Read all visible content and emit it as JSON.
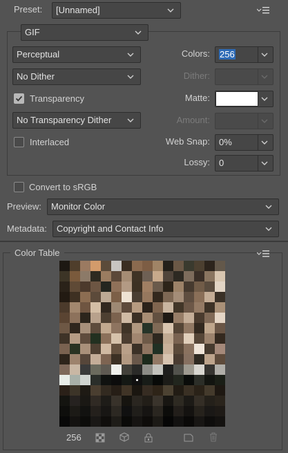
{
  "preset": {
    "label": "Preset:",
    "value": "[Unnamed]"
  },
  "format": {
    "value": "GIF"
  },
  "reduction": {
    "value": "Perceptual"
  },
  "dither_algo": {
    "value": "No Dither"
  },
  "transparency": {
    "label": "Transparency",
    "checked": true
  },
  "transparency_dither": {
    "value": "No Transparency Dither"
  },
  "interlaced": {
    "label": "Interlaced",
    "checked": false
  },
  "colors": {
    "label": "Colors:",
    "value": "256"
  },
  "dither": {
    "label": "Dither:",
    "value": ""
  },
  "matte": {
    "label": "Matte:",
    "color": "#ffffff"
  },
  "amount": {
    "label": "Amount:",
    "value": ""
  },
  "web_snap": {
    "label": "Web Snap:",
    "value": "0%"
  },
  "lossy": {
    "label": "Lossy:",
    "value": "0"
  },
  "convert_srgb": {
    "label": "Convert to sRGB",
    "checked": false
  },
  "preview": {
    "label": "Preview:",
    "value": "Monitor Color"
  },
  "metadata": {
    "label": "Metadata:",
    "value": "Copyright and Contact Info"
  },
  "color_table": {
    "title": "Color Table",
    "count": "256",
    "colors": [
      "#1d1812",
      "#4f3e2b",
      "#9b7a61",
      "#d39b6b",
      "#5b4b3a",
      "#c8c5c1",
      "#3a2e22",
      "#8b6a4f",
      "#7d5d44",
      "#a08466",
      "#24201a",
      "#6b5846",
      "#3a3a2e",
      "#4c4030",
      "#2c241c",
      "#63584a",
      "#3c3426",
      "#7a5a3c",
      "#8c7a68",
      "#2e2a20",
      "#9a7c60",
      "#5c4838",
      "#a58c74",
      "#3f3325",
      "#6e6054",
      "#c7a98b",
      "#50443a",
      "#2d2922",
      "#7d6c5c",
      "#3a2f27",
      "#8a7560",
      "#d8c6b0",
      "#2a2219",
      "#5f4a36",
      "#4c3a2c",
      "#6d5643",
      "#24261f",
      "#8f7159",
      "#b39a84",
      "#3d3123",
      "#a07f63",
      "#6a5a4b",
      "#2d2419",
      "#9c8268",
      "#463a2f",
      "#715c48",
      "#5a4c3e",
      "#e2d5c5",
      "#221a12",
      "#3e3022",
      "#8c6d52",
      "#5c4a3a",
      "#bca994",
      "#7c5f47",
      "#efe2d3",
      "#4a3e32",
      "#96785e",
      "#33281d",
      "#7e6854",
      "#a48d78",
      "#5f4e40",
      "#8a6f58",
      "#c4ad96",
      "#3a3127",
      "#4b3a2b",
      "#a2876e",
      "#6f5541",
      "#d4bea5",
      "#31281f",
      "#9e8974",
      "#5e4a3b",
      "#b79b81",
      "#2b221a",
      "#80654f",
      "#c9b5a0",
      "#423628",
      "#6c5747",
      "#947a64",
      "#3d3226",
      "#aa9178",
      "#5a4432",
      "#8d725c",
      "#2c251c",
      "#b8a18c",
      "#4d3f31",
      "#7b624e",
      "#d0baa4",
      "#3b2f24",
      "#a88d74",
      "#625040",
      "#1f1a14",
      "#977d67",
      "#c5ae98",
      "#4a3b2e",
      "#816a57",
      "#e5d6c6",
      "#6e5845",
      "#2f261d",
      "#a7907b",
      "#5d4b3c",
      "#c2a98f",
      "#8e7460",
      "#403427",
      "#b0977f",
      "#263428",
      "#7f6a56",
      "#d9c5af",
      "#554536",
      "#917863",
      "#33291f",
      "#bfa68c",
      "#6a5646",
      "#3f3327",
      "#b59c85",
      "#5f4c3d",
      "#223020",
      "#8b705a",
      "#d6c2ab",
      "#4c3d30",
      "#a18670",
      "#6e5a48",
      "#2e281f",
      "#c0a991",
      "#7a6351",
      "#e1cfbb",
      "#564637",
      "#9b826c",
      "#34291f",
      "#7a6250",
      "#2a3322",
      "#a9907a",
      "#4f4032",
      "#d0b9a2",
      "#65513f",
      "#b9a089",
      "#3b3127",
      "#8f7561",
      "#203024",
      "#c8b19a",
      "#5b4a3a",
      "#8a725f",
      "#efe4d8",
      "#463a2e",
      "#a5897a",
      "#2d241b",
      "#9d836d",
      "#56463a",
      "#c4ad98",
      "#7e6452",
      "#3c3024",
      "#b29982",
      "#68574a",
      "#1c2a1c",
      "#927965",
      "#d7c4b0",
      "#4a3c31",
      "#867060",
      "#2f2a22",
      "#bda48c",
      "#5e4b3b",
      "#7e685a",
      "#c9b7a4",
      "#3a3a3a",
      "#6b6b5e",
      "#5f5a52",
      "#f0f0ec",
      "#42403a",
      "#2a2a28",
      "#8d8d87",
      "#c2c2bc",
      "#1e1e1c",
      "#52524c",
      "#9e9a90",
      "#d8d6d0",
      "#363430",
      "#b0aea8",
      "#e8ece8",
      "#a8b0a8",
      "#d0d4d0",
      "#2a2e2a",
      "#101210",
      "#0c0c0c",
      "#141814",
      "#101010",
      "#181c18",
      "#080a08",
      "#1c1c18",
      "#22261e",
      "#0a0c0a",
      "#2c2e28",
      "#121410",
      "#1a1e16",
      "#2a2018",
      "#3c3428",
      "#1e1a14",
      "#4a3e30",
      "#322a20",
      "#261e16",
      "#403426",
      "#1a1610",
      "#362c22",
      "#2e2418",
      "#4c4232",
      "#221c14",
      "#3a3024",
      "#2a2218",
      "#443a2c",
      "#1e1812",
      "#141410",
      "#262220",
      "#1a1814",
      "#302a24",
      "#1e1c18",
      "#38322a",
      "#16140f",
      "#2a2620",
      "#221e18",
      "#3a342c",
      "#181612",
      "#2e2a22",
      "#1c1a16",
      "#342e26",
      "#24201a",
      "#2a241c",
      "#0e0e0c",
      "#1c1a16",
      "#121210",
      "#24201c",
      "#181614",
      "#2c2822",
      "#101010",
      "#201e1a",
      "#161412",
      "#2a2620",
      "#0c0c0a",
      "#221e1a",
      "#141210",
      "#26221c",
      "#1a1816",
      "#1e1a16",
      "#080808",
      "#141210",
      "#0c0c0a",
      "#1a1816",
      "#100e0c",
      "#1e1c18",
      "#0a0a08",
      "#161412",
      "#0e0c0a",
      "#1c1a16",
      "#060606",
      "#121110",
      "#0a0908",
      "#181614",
      "#0e0d0c",
      "#141210"
    ]
  }
}
